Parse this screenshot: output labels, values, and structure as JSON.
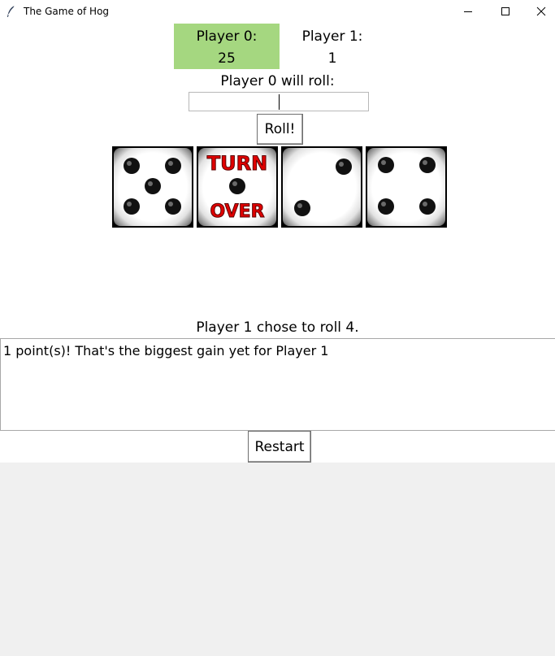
{
  "window": {
    "title": "The Game of Hog",
    "icon": "feather-icon",
    "controls": [
      "minimize-icon",
      "maximize-icon",
      "close-icon"
    ]
  },
  "scores": {
    "player0": {
      "label": "Player 0:",
      "value": "25",
      "highlight_color": "#a5d780"
    },
    "player1": {
      "label": "Player 1:",
      "value": "1"
    }
  },
  "roll_prompt": "Player 0 will roll:",
  "roll_input": {
    "value": ""
  },
  "roll_button": "Roll!",
  "dice": [
    {
      "face": 5
    },
    {
      "face": "turn-over",
      "text_top": "TURN",
      "text_bottom": "OVER",
      "text_color": "#e00000"
    },
    {
      "face": 2
    },
    {
      "face": 4
    }
  ],
  "status": "Player 1 chose to roll 4.",
  "message": "1 point(s)! That's the biggest gain yet for Player 1",
  "restart_button": "Restart"
}
